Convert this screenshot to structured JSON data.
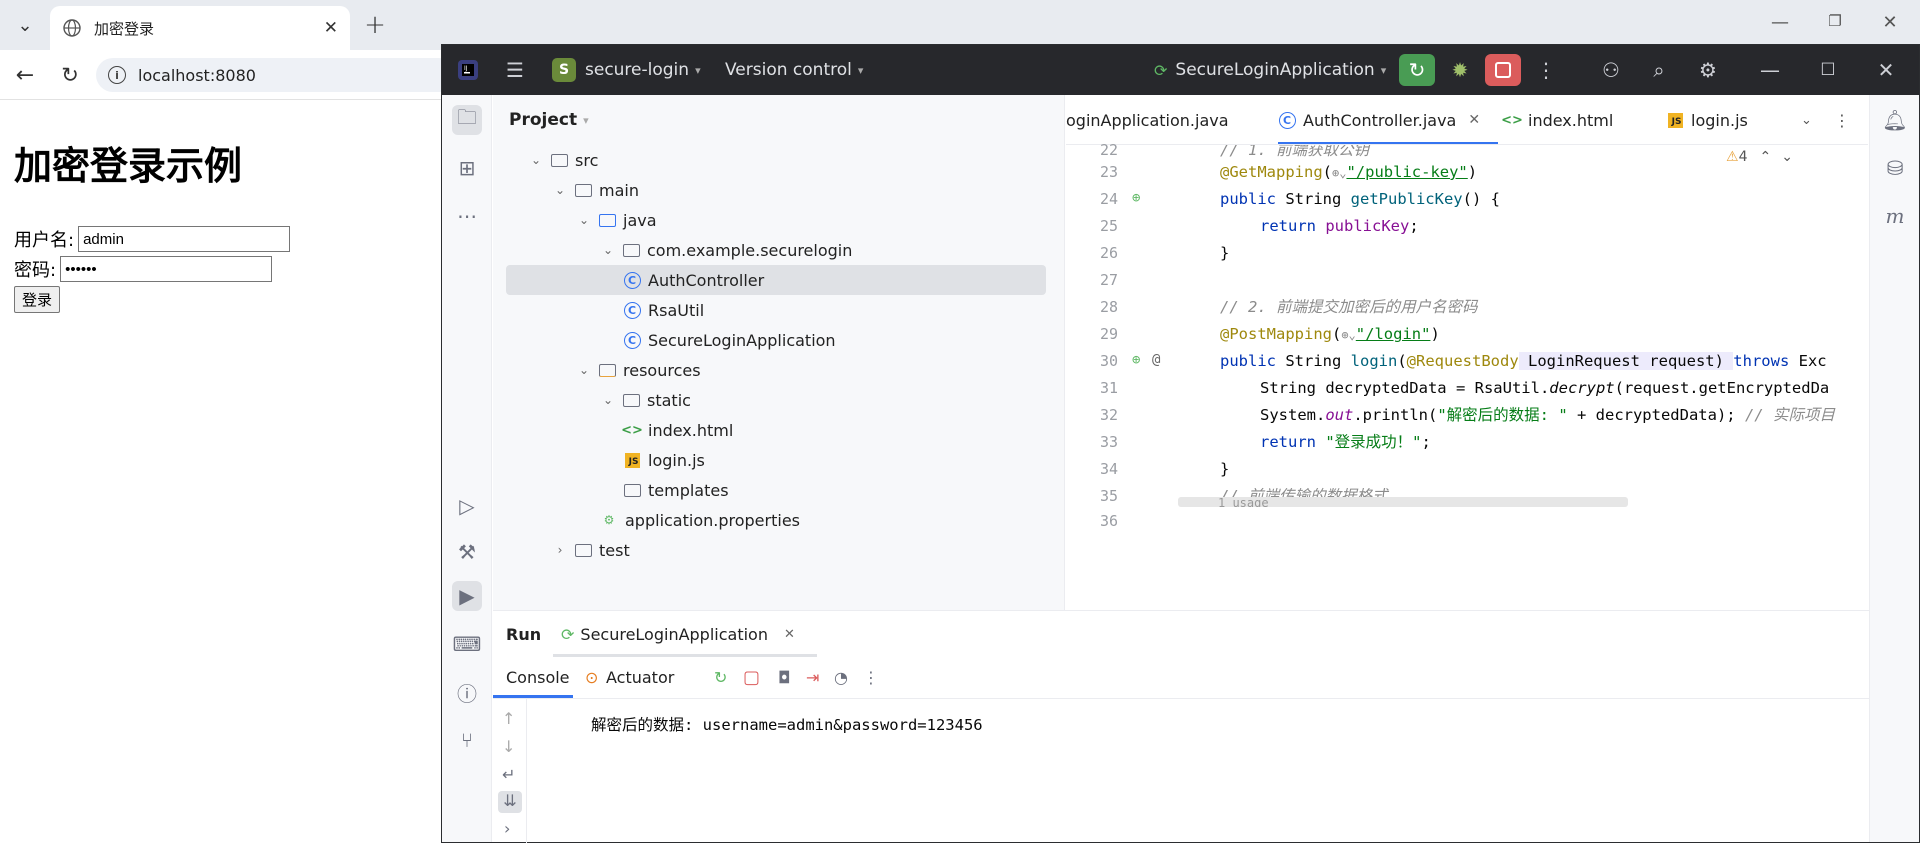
{
  "browser": {
    "tab_title": "加密登录",
    "url": "localhost:8080"
  },
  "page": {
    "heading": "加密登录示例",
    "username_label": "用户名:",
    "username_value": "admin",
    "password_label": "密码:",
    "password_value": "••••••",
    "login_button": "登录"
  },
  "ide": {
    "project_name": "secure-login",
    "vcs_label": "Version control",
    "run_config": "SecureLoginApplication",
    "project_panel_title": "Project",
    "tree": [
      {
        "label": "src"
      },
      {
        "label": "main"
      },
      {
        "label": "java"
      },
      {
        "label": "com.example.securelogin"
      },
      {
        "label": "AuthController"
      },
      {
        "label": "RsaUtil"
      },
      {
        "label": "SecureLoginApplication"
      },
      {
        "label": "resources"
      },
      {
        "label": "static"
      },
      {
        "label": "index.html"
      },
      {
        "label": "login.js"
      },
      {
        "label": "templates"
      },
      {
        "label": "application.properties"
      },
      {
        "label": "test"
      }
    ],
    "editor_tabs": [
      {
        "label": "oginApplication.java"
      },
      {
        "label": "AuthController.java"
      },
      {
        "label": "index.html"
      },
      {
        "label": "login.js"
      }
    ],
    "warnings": "4",
    "line_numbers": [
      "22",
      "23",
      "24",
      "25",
      "26",
      "27",
      "28",
      "29",
      "30",
      "31",
      "32",
      "33",
      "34",
      "35",
      "36"
    ],
    "code": {
      "l22": "// 1. 前端获取公钥",
      "l23_ann": "@GetMapping",
      "l23_str": "\"/public-key\"",
      "l24_kw": "public",
      "l24_rest": " String ",
      "l24_fn": "getPublicKey",
      "l24_end": "() {",
      "l25_kw": "return",
      "l25_fld": "publicKey",
      "l26": "}",
      "l28": "// 2. 前端提交加密后的用户名密码",
      "l29_ann": "@PostMapping",
      "l29_str": "\"/login\"",
      "l30_kw": "public",
      "l30_fn": "login",
      "l30_ann": "@RequestBody",
      "l30_rest": " LoginRequest request) ",
      "l30_kw2": "throws",
      "l30_tail": " Exc",
      "l31_a": "String decryptedData = RsaUtil.",
      "l31_it": "decrypt",
      "l31_b": "(request.getEncryptedDa",
      "l32_a": "System.",
      "l32_fld": "out",
      "l32_b": ".println(",
      "l32_str": "\"解密后的数据: \"",
      "l32_c": " + decryptedData); ",
      "l32_cm": "// 实际项目",
      "l33_kw": "return",
      "l33_str": "\"登录成功！\"",
      "l34": "}",
      "l36": "// 前端传输的数据格式",
      "usage_hint": "1 usage"
    },
    "run": {
      "tab_run": "Run",
      "tab_app": "SecureLoginApplication",
      "console_tab": "Console",
      "actuator_tab": "Actuator",
      "output": "解密后的数据: username=admin&password=123456"
    }
  },
  "colors": {
    "accent": "#3574f0",
    "ide_title_bg": "#27282c",
    "run_green": "#499c54",
    "stop_red": "#db5c5c"
  }
}
